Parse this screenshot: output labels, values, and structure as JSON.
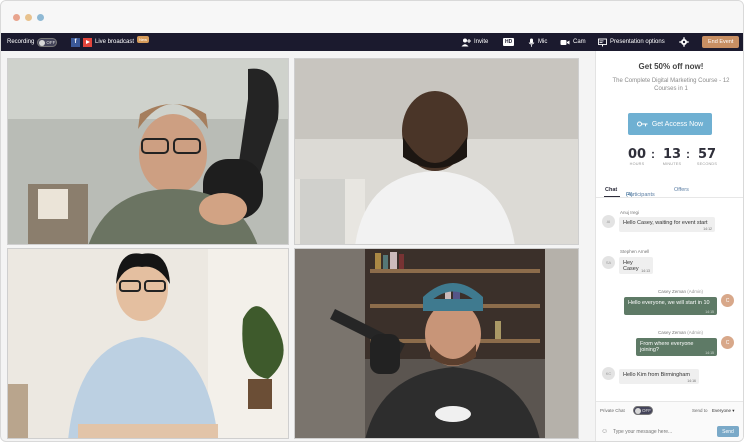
{
  "window_dots": [
    "#e8a48e",
    "#e8c28e",
    "#8fb9d4"
  ],
  "topbar": {
    "recording_label": "Recording",
    "recording_toggle": "OFF",
    "live_broadcast_label": "Live broadcast",
    "new_badge": "New",
    "invite_label": "Invite",
    "hd_label": "HD",
    "mic_label": "Mic",
    "cam_label": "Cam",
    "presentation_label": "Presentation options",
    "end_event_label": "End Event"
  },
  "promo": {
    "title": "Get 50% off now!",
    "subtitle": "The Complete Digital Marketing Course - 12 Courses in 1",
    "button_label": "Get Access Now",
    "countdown": [
      {
        "value": "00",
        "label": "HOURS"
      },
      {
        "value": "13",
        "label": "MINUTES"
      },
      {
        "value": "57",
        "label": "SECONDS"
      }
    ]
  },
  "tabs": {
    "chat": "Chat",
    "participants": "Participants",
    "participants_count": "(4)",
    "offers": "Offers"
  },
  "messages": [
    {
      "sender": "Anuj Iregi",
      "text": "Hello Casey, waiting for event start",
      "time": "14:12",
      "initials": "AI"
    },
    {
      "sender": "Stephen Arnell",
      "text": "Hey Casey",
      "time": "14:13",
      "initials": "SA"
    },
    {
      "sender": "Casey Zeman",
      "role": "(Admin)",
      "text": "Hello everyone, we will start in 10",
      "time": "14:15",
      "initials": "C"
    },
    {
      "sender": "Casey Zeman",
      "role": "(Admin)",
      "text": "From where everyone joining?",
      "time": "14:15",
      "initials": "C"
    },
    {
      "text": "Hello Kim from Birmingham",
      "time": "14:16",
      "initials": "KC"
    }
  ],
  "chat_footer": {
    "private_chat_label": "Private Chat",
    "private_toggle": "OFF",
    "send_to_label": "Send to",
    "send_to_value": "Everyone",
    "input_placeholder": "Type your message here...",
    "send_label": "Send"
  },
  "colors": {
    "topbar_bg": "#1b1a2e",
    "accent": "#6fb0d2",
    "end_event": "#c88f63",
    "host_bubble": "#5e7a66"
  }
}
